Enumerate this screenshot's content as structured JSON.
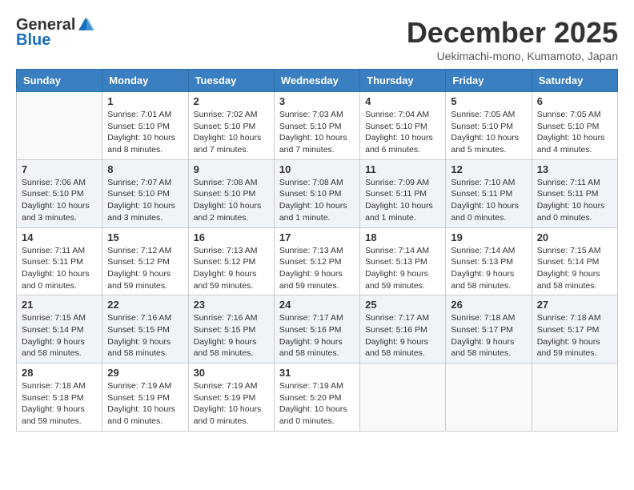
{
  "header": {
    "logo_general": "General",
    "logo_blue": "Blue",
    "month_title": "December 2025",
    "location": "Uekimachi-mono, Kumamoto, Japan"
  },
  "weekdays": [
    "Sunday",
    "Monday",
    "Tuesday",
    "Wednesday",
    "Thursday",
    "Friday",
    "Saturday"
  ],
  "weeks": [
    [
      {
        "day": "",
        "sunrise": "",
        "sunset": "",
        "daylight": ""
      },
      {
        "day": "1",
        "sunrise": "Sunrise: 7:01 AM",
        "sunset": "Sunset: 5:10 PM",
        "daylight": "Daylight: 10 hours and 8 minutes."
      },
      {
        "day": "2",
        "sunrise": "Sunrise: 7:02 AM",
        "sunset": "Sunset: 5:10 PM",
        "daylight": "Daylight: 10 hours and 7 minutes."
      },
      {
        "day": "3",
        "sunrise": "Sunrise: 7:03 AM",
        "sunset": "Sunset: 5:10 PM",
        "daylight": "Daylight: 10 hours and 7 minutes."
      },
      {
        "day": "4",
        "sunrise": "Sunrise: 7:04 AM",
        "sunset": "Sunset: 5:10 PM",
        "daylight": "Daylight: 10 hours and 6 minutes."
      },
      {
        "day": "5",
        "sunrise": "Sunrise: 7:05 AM",
        "sunset": "Sunset: 5:10 PM",
        "daylight": "Daylight: 10 hours and 5 minutes."
      },
      {
        "day": "6",
        "sunrise": "Sunrise: 7:05 AM",
        "sunset": "Sunset: 5:10 PM",
        "daylight": "Daylight: 10 hours and 4 minutes."
      }
    ],
    [
      {
        "day": "7",
        "sunrise": "Sunrise: 7:06 AM",
        "sunset": "Sunset: 5:10 PM",
        "daylight": "Daylight: 10 hours and 3 minutes."
      },
      {
        "day": "8",
        "sunrise": "Sunrise: 7:07 AM",
        "sunset": "Sunset: 5:10 PM",
        "daylight": "Daylight: 10 hours and 3 minutes."
      },
      {
        "day": "9",
        "sunrise": "Sunrise: 7:08 AM",
        "sunset": "Sunset: 5:10 PM",
        "daylight": "Daylight: 10 hours and 2 minutes."
      },
      {
        "day": "10",
        "sunrise": "Sunrise: 7:08 AM",
        "sunset": "Sunset: 5:10 PM",
        "daylight": "Daylight: 10 hours and 1 minute."
      },
      {
        "day": "11",
        "sunrise": "Sunrise: 7:09 AM",
        "sunset": "Sunset: 5:11 PM",
        "daylight": "Daylight: 10 hours and 1 minute."
      },
      {
        "day": "12",
        "sunrise": "Sunrise: 7:10 AM",
        "sunset": "Sunset: 5:11 PM",
        "daylight": "Daylight: 10 hours and 0 minutes."
      },
      {
        "day": "13",
        "sunrise": "Sunrise: 7:11 AM",
        "sunset": "Sunset: 5:11 PM",
        "daylight": "Daylight: 10 hours and 0 minutes."
      }
    ],
    [
      {
        "day": "14",
        "sunrise": "Sunrise: 7:11 AM",
        "sunset": "Sunset: 5:11 PM",
        "daylight": "Daylight: 10 hours and 0 minutes."
      },
      {
        "day": "15",
        "sunrise": "Sunrise: 7:12 AM",
        "sunset": "Sunset: 5:12 PM",
        "daylight": "Daylight: 9 hours and 59 minutes."
      },
      {
        "day": "16",
        "sunrise": "Sunrise: 7:13 AM",
        "sunset": "Sunset: 5:12 PM",
        "daylight": "Daylight: 9 hours and 59 minutes."
      },
      {
        "day": "17",
        "sunrise": "Sunrise: 7:13 AM",
        "sunset": "Sunset: 5:12 PM",
        "daylight": "Daylight: 9 hours and 59 minutes."
      },
      {
        "day": "18",
        "sunrise": "Sunrise: 7:14 AM",
        "sunset": "Sunset: 5:13 PM",
        "daylight": "Daylight: 9 hours and 59 minutes."
      },
      {
        "day": "19",
        "sunrise": "Sunrise: 7:14 AM",
        "sunset": "Sunset: 5:13 PM",
        "daylight": "Daylight: 9 hours and 58 minutes."
      },
      {
        "day": "20",
        "sunrise": "Sunrise: 7:15 AM",
        "sunset": "Sunset: 5:14 PM",
        "daylight": "Daylight: 9 hours and 58 minutes."
      }
    ],
    [
      {
        "day": "21",
        "sunrise": "Sunrise: 7:15 AM",
        "sunset": "Sunset: 5:14 PM",
        "daylight": "Daylight: 9 hours and 58 minutes."
      },
      {
        "day": "22",
        "sunrise": "Sunrise: 7:16 AM",
        "sunset": "Sunset: 5:15 PM",
        "daylight": "Daylight: 9 hours and 58 minutes."
      },
      {
        "day": "23",
        "sunrise": "Sunrise: 7:16 AM",
        "sunset": "Sunset: 5:15 PM",
        "daylight": "Daylight: 9 hours and 58 minutes."
      },
      {
        "day": "24",
        "sunrise": "Sunrise: 7:17 AM",
        "sunset": "Sunset: 5:16 PM",
        "daylight": "Daylight: 9 hours and 58 minutes."
      },
      {
        "day": "25",
        "sunrise": "Sunrise: 7:17 AM",
        "sunset": "Sunset: 5:16 PM",
        "daylight": "Daylight: 9 hours and 58 minutes."
      },
      {
        "day": "26",
        "sunrise": "Sunrise: 7:18 AM",
        "sunset": "Sunset: 5:17 PM",
        "daylight": "Daylight: 9 hours and 58 minutes."
      },
      {
        "day": "27",
        "sunrise": "Sunrise: 7:18 AM",
        "sunset": "Sunset: 5:17 PM",
        "daylight": "Daylight: 9 hours and 59 minutes."
      }
    ],
    [
      {
        "day": "28",
        "sunrise": "Sunrise: 7:18 AM",
        "sunset": "Sunset: 5:18 PM",
        "daylight": "Daylight: 9 hours and 59 minutes."
      },
      {
        "day": "29",
        "sunrise": "Sunrise: 7:19 AM",
        "sunset": "Sunset: 5:19 PM",
        "daylight": "Daylight: 10 hours and 0 minutes."
      },
      {
        "day": "30",
        "sunrise": "Sunrise: 7:19 AM",
        "sunset": "Sunset: 5:19 PM",
        "daylight": "Daylight: 10 hours and 0 minutes."
      },
      {
        "day": "31",
        "sunrise": "Sunrise: 7:19 AM",
        "sunset": "Sunset: 5:20 PM",
        "daylight": "Daylight: 10 hours and 0 minutes."
      },
      {
        "day": "",
        "sunrise": "",
        "sunset": "",
        "daylight": ""
      },
      {
        "day": "",
        "sunrise": "",
        "sunset": "",
        "daylight": ""
      },
      {
        "day": "",
        "sunrise": "",
        "sunset": "",
        "daylight": ""
      }
    ]
  ]
}
